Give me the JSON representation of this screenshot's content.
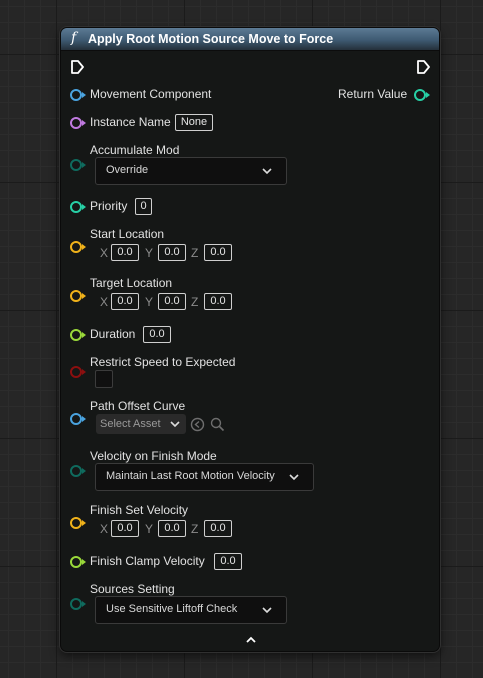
{
  "node": {
    "title": "Apply Root Motion Source Move to Force",
    "function_icon": "f"
  },
  "pins": {
    "movement_component": "Movement Component",
    "return_value": "Return Value",
    "instance_name": {
      "label": "Instance Name",
      "value": "None"
    },
    "accumulate_mod": {
      "label": "Accumulate Mod",
      "value": "Override"
    },
    "priority": {
      "label": "Priority",
      "value": "0"
    },
    "start_location": {
      "label": "Start Location",
      "x_label": "X",
      "y_label": "Y",
      "z_label": "Z",
      "x": "0.0",
      "y": "0.0",
      "z": "0.0"
    },
    "target_location": {
      "label": "Target Location",
      "x_label": "X",
      "y_label": "Y",
      "z_label": "Z",
      "x": "0.0",
      "y": "0.0",
      "z": "0.0"
    },
    "duration": {
      "label": "Duration",
      "value": "0.0"
    },
    "restrict_speed": {
      "label": "Restrict Speed to Expected",
      "checked": false
    },
    "path_offset_curve": {
      "label": "Path Offset Curve",
      "value": "Select Asset"
    },
    "velocity_on_finish_mode": {
      "label": "Velocity on Finish Mode",
      "value": "Maintain Last Root Motion Velocity"
    },
    "finish_set_velocity": {
      "label": "Finish Set Velocity",
      "x_label": "X",
      "y_label": "Y",
      "z_label": "Z",
      "x": "0.0",
      "y": "0.0",
      "z": "0.0"
    },
    "finish_clamp_velocity": {
      "label": "Finish Clamp Velocity",
      "value": "0.0"
    },
    "sources_setting": {
      "label": "Sources Setting",
      "value": "Use Sensitive Liftoff Check"
    }
  },
  "colors": {
    "object_pin": "#4aa3df",
    "name_pin": "#c07ae0",
    "enum_pin": "#0f6b5e",
    "int_pin": "#27d0a6",
    "vector_pin": "#f0b21a",
    "float_pin": "#9ad93a",
    "bool_pin": "#8c0f0f"
  },
  "icons": [
    "function-icon",
    "exec-in-icon",
    "exec-out-icon",
    "chevron-down-icon",
    "browse-arrow-icon",
    "search-icon",
    "collapse-arrow-icon"
  ]
}
